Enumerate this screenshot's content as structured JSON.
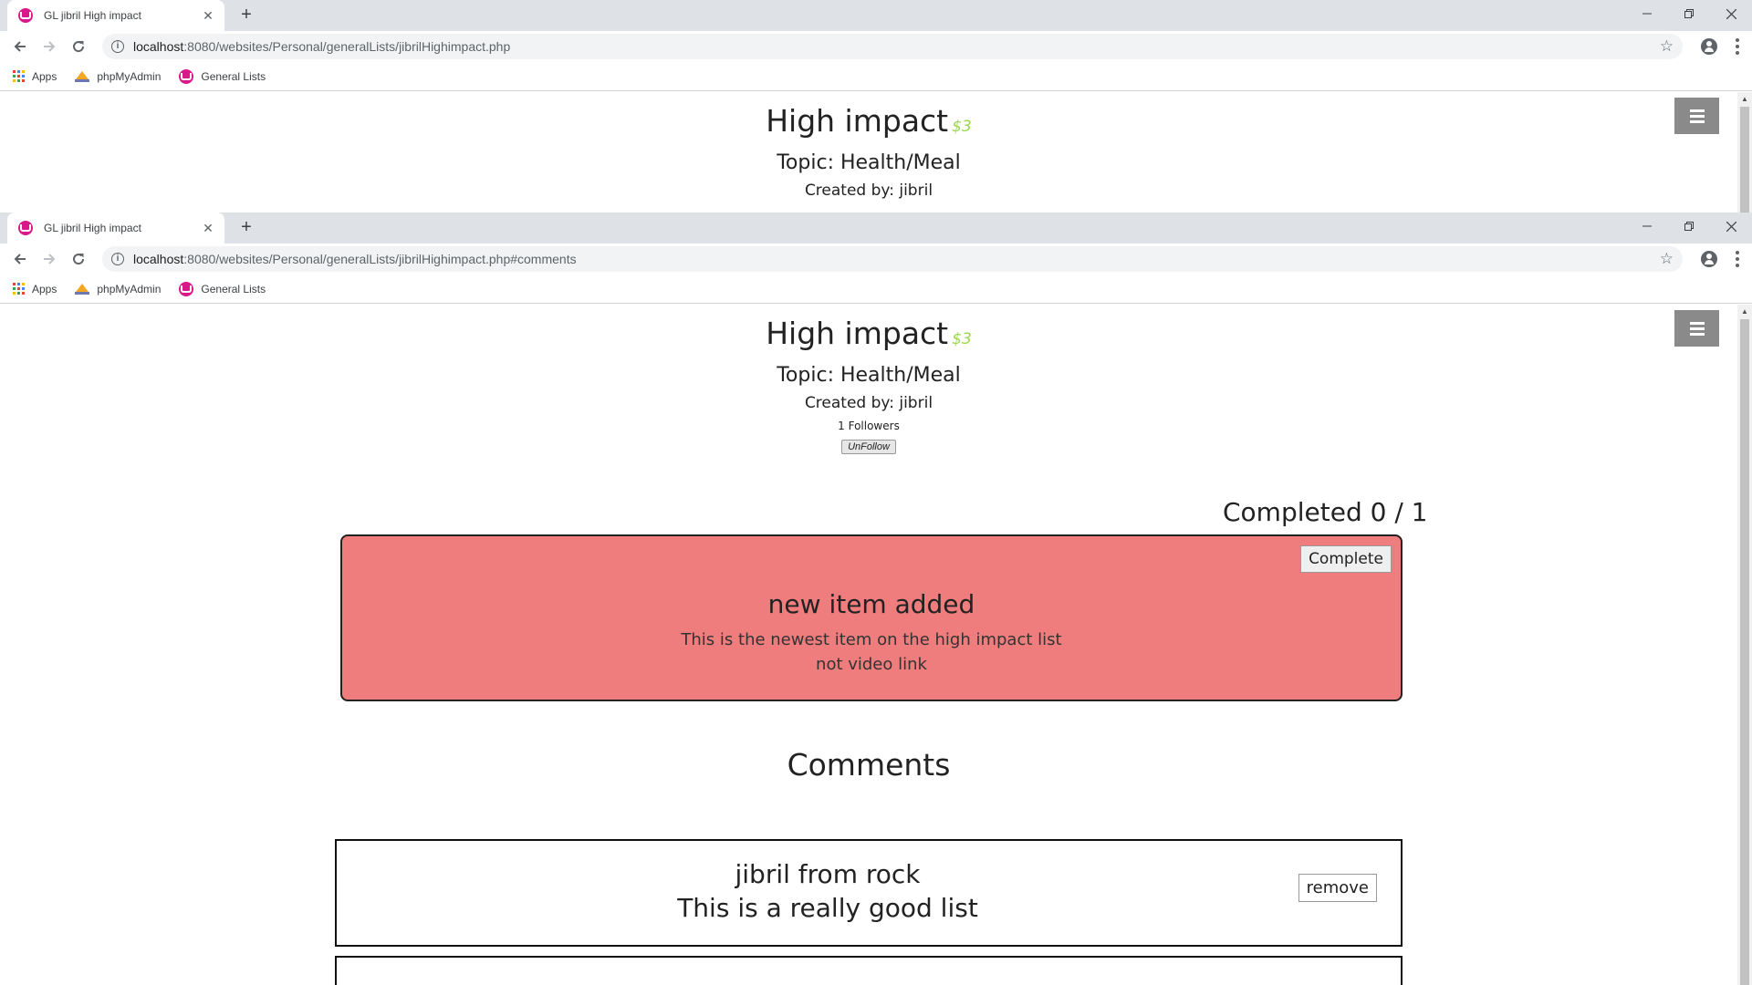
{
  "window1": {
    "tab_title": "GL jibril High impact",
    "url_host": "localhost",
    "url_rest": ":8080/websites/Personal/generalLists/jibrilHighimpact.php"
  },
  "window2": {
    "tab_title": "GL jibril High impact",
    "url_host": "localhost",
    "url_rest": ":8080/websites/Personal/generalLists/jibrilHighimpact.php#comments"
  },
  "bookmarks": {
    "apps": "Apps",
    "phpmyadmin": "phpMyAdmin",
    "general_lists": "General Lists"
  },
  "list": {
    "title": "High impact",
    "cost": "$3",
    "topic": "Topic: Health/Meal",
    "created_by": "Created by: jibril",
    "followers": "1 Followers",
    "unfollow_label": "UnFollow",
    "completed": "Completed 0 / 1"
  },
  "item": {
    "complete_label": "Complete",
    "title": "new item added",
    "description": "This is the newest item on the high impact list",
    "link": "not video link",
    "status_color": "#f07d7d"
  },
  "comments": {
    "heading": "Comments",
    "items": [
      {
        "author": "jibril from rock",
        "text": "This is a really good list",
        "remove_label": "remove"
      }
    ]
  },
  "colors": {
    "accent_cost": "#9bd84e",
    "favicon": "#d9198a",
    "hamburger": "#8a8a8a"
  }
}
